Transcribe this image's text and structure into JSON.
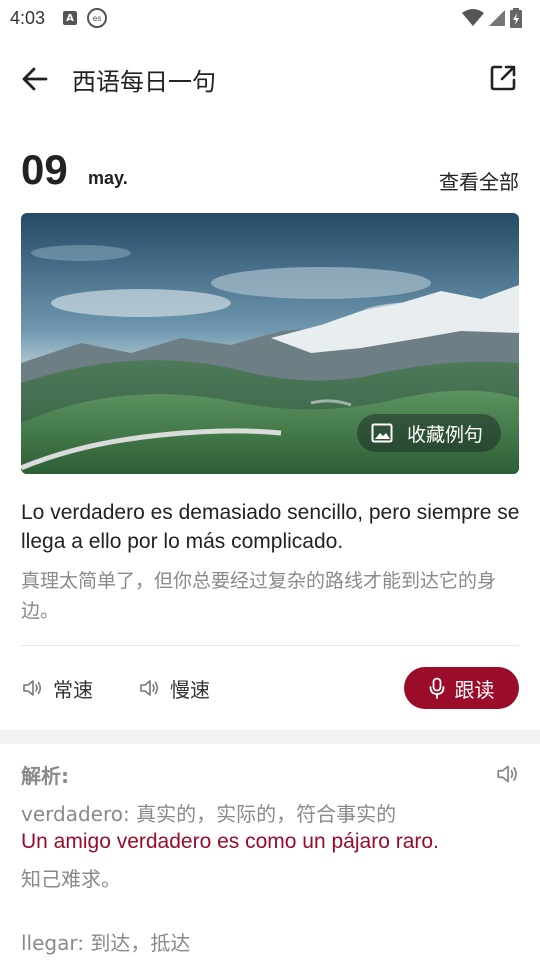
{
  "status": {
    "time": "4:03",
    "icon_a": "A",
    "icon_es": "es"
  },
  "appbar": {
    "title": "西语每日一句"
  },
  "date": {
    "day": "09",
    "month": "may.",
    "view_all": "查看全部"
  },
  "hero": {
    "favorite_label": "收藏例句"
  },
  "sentence": {
    "spanish": "Lo verdadero es demasiado sencillo, pero siempre se llega a ello por lo más complicado.",
    "chinese": "真理太简单了，但你总要经过复杂的路线才能到达它的身边。"
  },
  "audio": {
    "normal_label": "常速",
    "slow_label": "慢速",
    "follow_label": "跟读"
  },
  "analysis": {
    "title": "解析:",
    "items": [
      {
        "word": "verdadero: 真实的，实际的，符合事实的",
        "example_es": "Un amigo verdadero es como un pájaro raro.",
        "example_zh": "知己难求。"
      },
      {
        "word": "llegar: 到达，抵达"
      }
    ]
  },
  "colors": {
    "accent": "#9b0b2a",
    "muted_text": "#8a8a8a"
  }
}
